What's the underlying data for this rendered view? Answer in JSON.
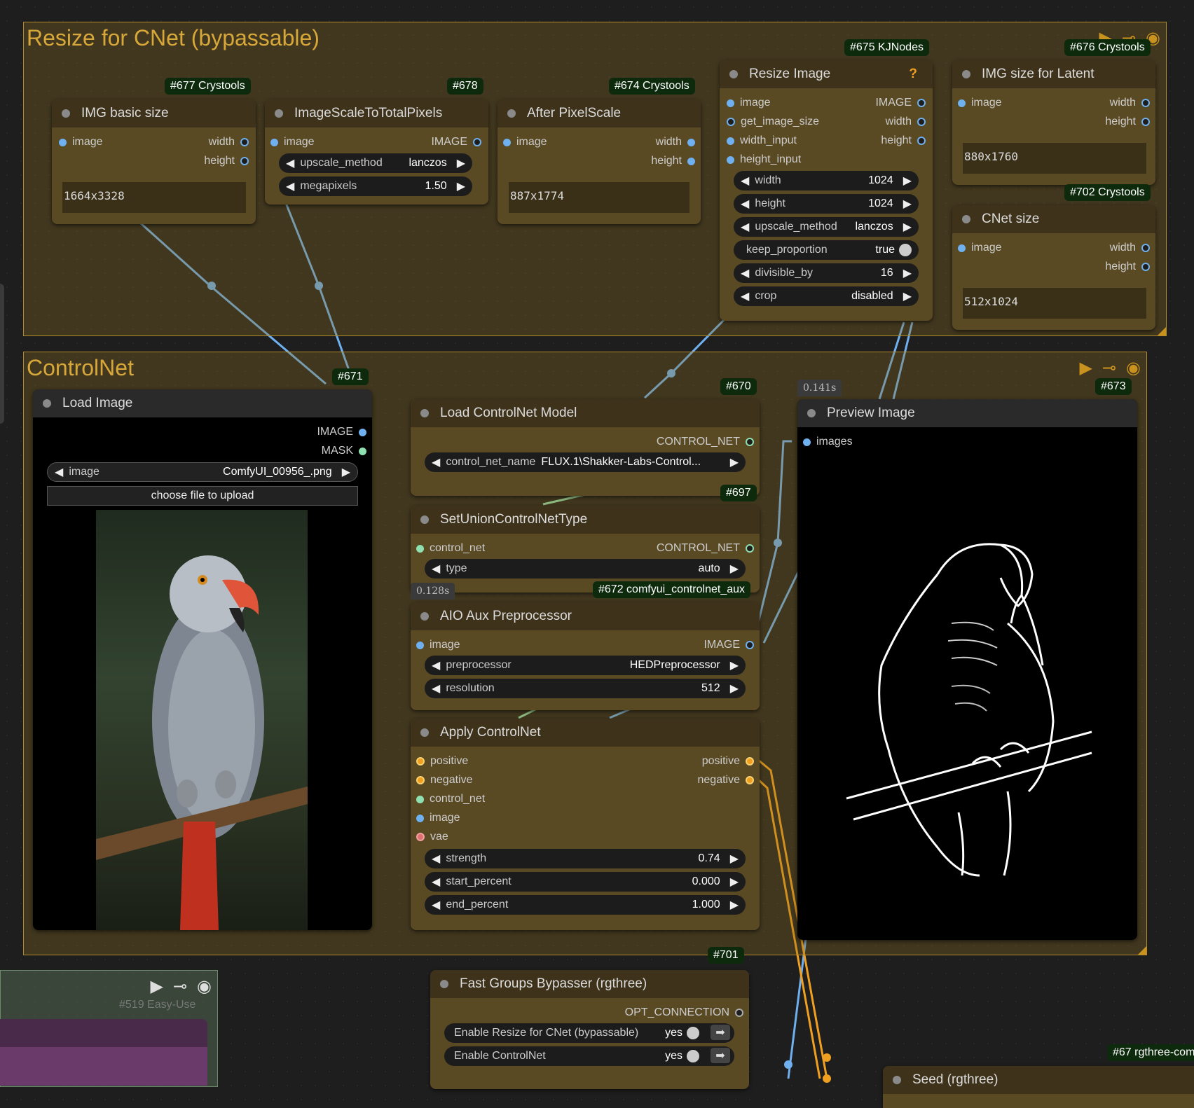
{
  "groups": {
    "resize": {
      "title": "Resize for CNet (bypassable)"
    },
    "controlnet": {
      "title": "ControlNet"
    }
  },
  "nodes": {
    "img_basic_size": {
      "badge": "#677 Crystools",
      "title": "IMG basic size",
      "in_image": "image",
      "out_width": "width",
      "out_height": "height",
      "value": "1664x3328"
    },
    "image_scale": {
      "badge": "#678",
      "title": "ImageScaleToTotalPixels",
      "in_image": "image",
      "out_image": "IMAGE",
      "upscale_method_label": "upscale_method",
      "upscale_method_value": "lanczos",
      "megapixels_label": "megapixels",
      "megapixels_value": "1.50"
    },
    "after_pixelscale": {
      "badge": "#674 Crystools",
      "title": "After PixelScale",
      "in_image": "image",
      "out_width": "width",
      "out_height": "height",
      "value": "887x1774"
    },
    "resize_image": {
      "badge": "#675 KJNodes",
      "title": "Resize Image",
      "help": "?",
      "in_image": "image",
      "in_get_image_size": "get_image_size",
      "in_width_input": "width_input",
      "in_height_input": "height_input",
      "out_image": "IMAGE",
      "out_width": "width",
      "out_height": "height",
      "width_label": "width",
      "width_value": "1024",
      "height_label": "height",
      "height_value": "1024",
      "upscale_label": "upscale_method",
      "upscale_value": "lanczos",
      "keep_label": "keep_proportion",
      "keep_value": "true",
      "divisible_label": "divisible_by",
      "divisible_value": "16",
      "crop_label": "crop",
      "crop_value": "disabled"
    },
    "img_size_latent": {
      "badge": "#676 Crystools",
      "title": "IMG size for Latent",
      "in_image": "image",
      "out_width": "width",
      "out_height": "height",
      "value": "880x1760"
    },
    "cnet_size": {
      "badge": "#702 Crystools",
      "title": "CNet size",
      "in_image": "image",
      "out_width": "width",
      "out_height": "height",
      "value": "512x1024"
    },
    "load_image": {
      "badge": "#671",
      "title": "Load Image",
      "out_image": "IMAGE",
      "out_mask": "MASK",
      "image_label": "image",
      "image_value": "ComfyUI_00956_.png",
      "upload_label": "choose file to upload"
    },
    "load_cn_model": {
      "badge": "#670",
      "title": "Load ControlNet Model",
      "out": "CONTROL_NET",
      "name_label": "control_net_name",
      "name_value": "FLUX.1\\Shakker-Labs-Control..."
    },
    "set_union": {
      "badge": "#697",
      "title": "SetUnionControlNetType",
      "in_cn": "control_net",
      "out": "CONTROL_NET",
      "type_label": "type",
      "type_value": "auto",
      "timer": "0.128s"
    },
    "aio_aux": {
      "badge": "#672 comfyui_controlnet_aux",
      "title": "AIO Aux Preprocessor",
      "in_image": "image",
      "out_image": "IMAGE",
      "pre_label": "preprocessor",
      "pre_value": "HEDPreprocessor",
      "res_label": "resolution",
      "res_value": "512"
    },
    "apply_cn": {
      "title": "Apply ControlNet",
      "in_positive": "positive",
      "in_negative": "negative",
      "in_cn": "control_net",
      "in_image": "image",
      "in_vae": "vae",
      "out_positive": "positive",
      "out_negative": "negative",
      "strength_label": "strength",
      "strength_value": "0.74",
      "start_label": "start_percent",
      "start_value": "0.000",
      "end_label": "end_percent",
      "end_value": "1.000"
    },
    "preview_image": {
      "badge": "#673",
      "title": "Preview Image",
      "in_images": "images",
      "timer": "0.141s"
    },
    "fast_groups": {
      "badge": "#701",
      "title": "Fast Groups Bypasser (rgthree)",
      "out": "OPT_CONNECTION",
      "toggle1_label": "Enable Resize for CNet (bypassable)",
      "toggle1_value": "yes",
      "toggle2_label": "Enable ControlNet",
      "toggle2_value": "yes"
    },
    "seed": {
      "title": "Seed (rgthree)",
      "badge": "#67 rgthree-com"
    },
    "easy_use": {
      "badge": "#519 Easy-Use"
    }
  },
  "colors": {
    "group_border": "#b58b2a",
    "node_body": "#5a4a24",
    "node_head": "#3e321a",
    "link_image": "#6fb0f0",
    "link_controlnet": "#8fe0b0",
    "link_conditioning": "#f0a020"
  }
}
